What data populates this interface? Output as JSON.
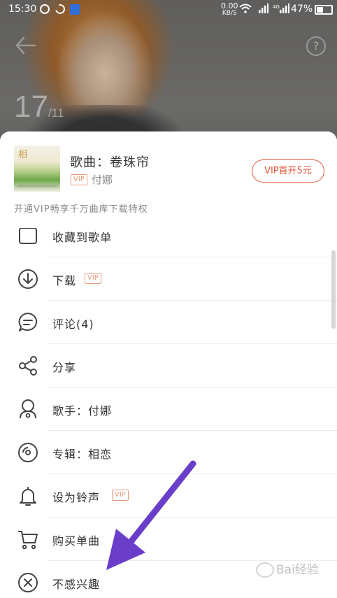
{
  "status_bar": {
    "time": "15:30",
    "net_speed_value": "0.00",
    "net_speed_unit": "KB/S",
    "signal_label": "4G",
    "battery": "47%"
  },
  "header": {
    "page_current": "17",
    "page_total": "/11"
  },
  "song": {
    "cover_text": "相",
    "title": "歌曲：卷珠帘",
    "vip_tag": "VIP",
    "artist": "付娜",
    "vip_button": "VIP首开5元",
    "vip_promo": "开通VIP畅享千万曲库下载特权"
  },
  "menu": [
    {
      "label": "收藏到歌单",
      "icon": "add-to-playlist-icon"
    },
    {
      "label": "下载",
      "icon": "download-icon",
      "vip": "VIP"
    },
    {
      "label": "评论(4)",
      "icon": "comment-icon"
    },
    {
      "label": "分享",
      "icon": "share-icon"
    },
    {
      "label": "歌手：付娜",
      "icon": "singer-icon"
    },
    {
      "label": "专辑：相恋",
      "icon": "album-icon"
    },
    {
      "label": "设为铃声",
      "icon": "bell-icon",
      "vip": "VIP"
    },
    {
      "label": "购买单曲",
      "icon": "cart-icon"
    },
    {
      "label": "不感兴趣",
      "icon": "not-interested-icon"
    }
  ],
  "watermark": "Bai经验",
  "colors": {
    "accent": "#e0553a",
    "vip_tag": "#e59a7a",
    "arrow": "#6a3ec8",
    "text": "#333333"
  }
}
